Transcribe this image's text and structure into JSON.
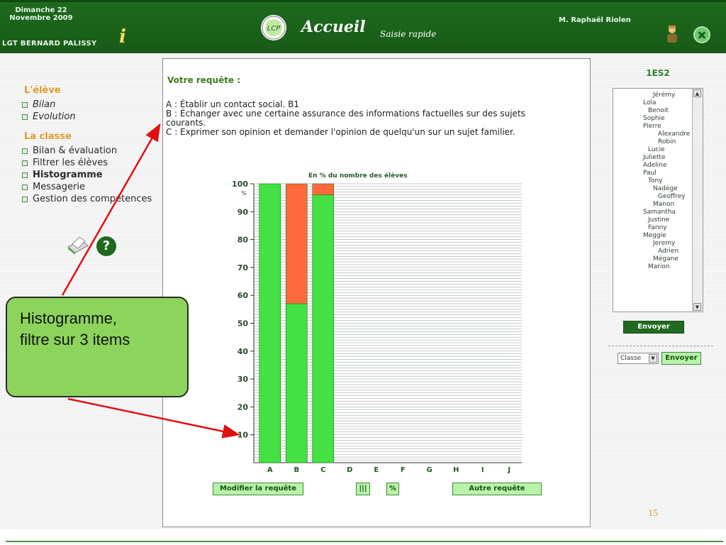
{
  "header": {
    "date": "Dimanche 22 Novembre 2009",
    "school": "LGT BERNARD PALISSY",
    "title": "Accueil",
    "subtitle": "Saisie rapide",
    "logo_text": "LCP",
    "user": "M. Raphaël Riolen"
  },
  "left_nav": {
    "student_heading": "L'élève",
    "student_items": [
      "Bilan",
      "Evolution"
    ],
    "class_heading": "La classe",
    "class_items": [
      "Bilan & évaluation",
      "Filtrer les élèves",
      "Histogramme",
      "Messagerie",
      "Gestion des compétences"
    ],
    "help_glyph": "?"
  },
  "main": {
    "request_title": "Votre requête :",
    "criteria": [
      "A : Établir un contact social. B1",
      "B : Échanger avec une certaine assurance des informations factuelles sur des sujets courants.",
      "C : Exprimer son opinion et demander l'opinion de quelqu'un sur un sujet familier."
    ],
    "buttons": {
      "modify": "Modifier la requête",
      "bars": "|||",
      "percent": "%",
      "other": "Autre requête"
    }
  },
  "chart_data": {
    "type": "bar",
    "subtitle": "En % du nombre des élèves",
    "unit": "%",
    "categories": [
      "A",
      "B",
      "C",
      "D",
      "E",
      "F",
      "G",
      "H",
      "I",
      "J"
    ],
    "series": [
      {
        "color": "#44e044",
        "values": [
          100,
          57,
          96,
          0,
          0,
          0,
          0,
          0,
          0,
          0
        ]
      },
      {
        "color": "#ff6a3c",
        "values": [
          0,
          43,
          4,
          0,
          0,
          0,
          0,
          0,
          0,
          0
        ]
      }
    ],
    "ylim": [
      0,
      100
    ],
    "yticks": [
      10,
      20,
      30,
      40,
      50,
      60,
      70,
      80,
      90,
      100
    ]
  },
  "right_panel": {
    "class_name": "1ES2",
    "students": [
      "Jérémy",
      "Lola",
      "Benoit",
      "Sophie",
      "Pierre",
      "Alexandre",
      "Robin",
      "Lucie",
      "Juliette",
      "Adeline",
      "Paul",
      "Tony",
      "Nadège",
      "Geoffrey",
      "Manon",
      "Samantha",
      "Justine",
      "Fanny",
      "Meggie",
      "Jeremy",
      "Adrien",
      "Mégane",
      "Marion"
    ],
    "send_label": "Envoyer",
    "select_value": "Classe",
    "send2_label": "Envoyer"
  },
  "callout": {
    "line1": "Histogramme,",
    "line2": "filtre sur 3 items"
  },
  "slide_number": "15",
  "colors": {
    "header": "#1f6a1f",
    "accent_orange": "#e39a2a",
    "bar_green": "#44e044",
    "bar_red": "#ff6a3c",
    "callout": "#8dd45c",
    "arrow": "#e01010"
  }
}
